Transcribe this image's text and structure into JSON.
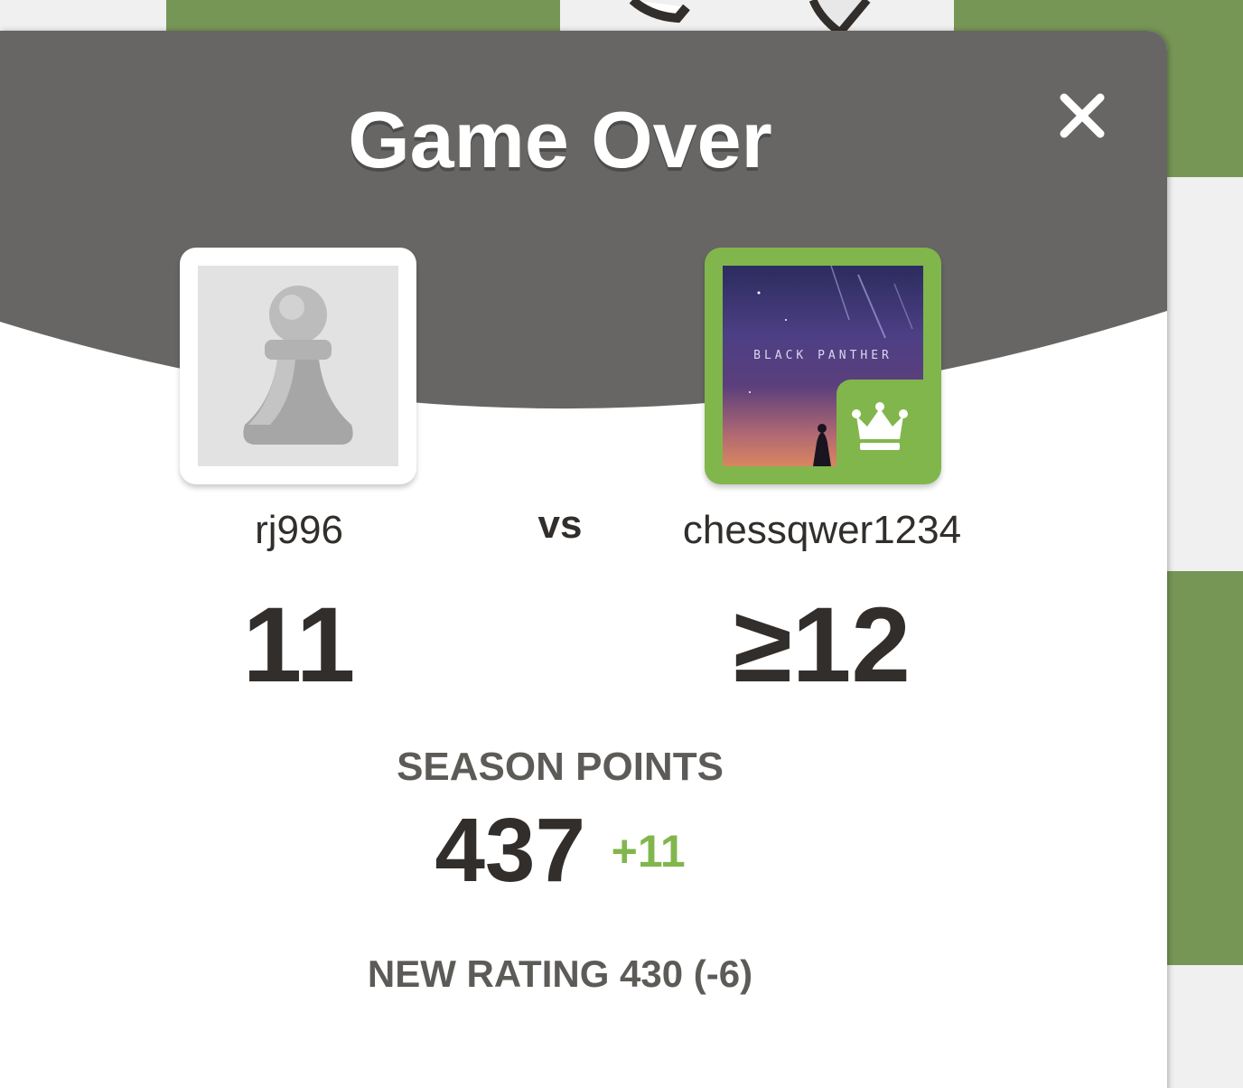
{
  "modal": {
    "title": "Game Over",
    "close_icon": "close-icon",
    "vs_label": "vs"
  },
  "players": {
    "left": {
      "username": "rj996",
      "score": "11",
      "avatar_icon": "pawn-icon"
    },
    "right": {
      "username": "chessqwer1234",
      "score": "≥12",
      "avatar_text": "BLACK PANTHER",
      "badge_icon": "crown-icon"
    }
  },
  "season": {
    "label": "SEASON POINTS",
    "points": "437",
    "delta": "+11"
  },
  "rating": {
    "text": "NEW RATING 430 (-6)"
  },
  "colors": {
    "header": "#676664",
    "accent_green": "#81b64c",
    "board_green": "#769656",
    "text_dark": "#312e2b",
    "text_gray": "#5d5b58"
  }
}
